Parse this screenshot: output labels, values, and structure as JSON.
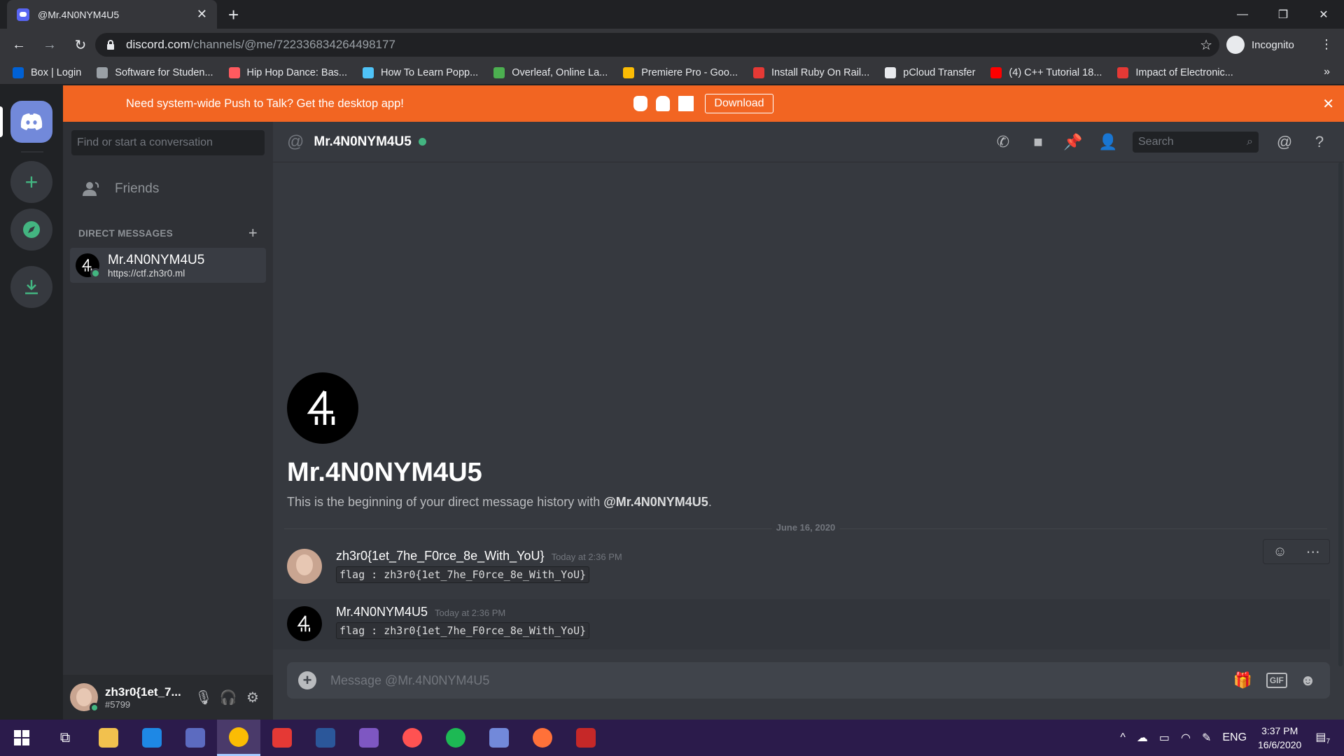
{
  "browser": {
    "tab_title": "@Mr.4N0NYM4U5",
    "url_host": "discord.com",
    "url_path": "/channels/@me/722336834264498177",
    "profile_label": "Incognito",
    "bookmarks": [
      {
        "label": "Box | Login",
        "color": "#0061d5"
      },
      {
        "label": "Software for Studen...",
        "color": "#9aa0a6"
      },
      {
        "label": "Hip Hop Dance: Bas...",
        "color": "#ff5a5f"
      },
      {
        "label": "How To Learn Popp...",
        "color": "#4fc3f7"
      },
      {
        "label": "Overleaf, Online La...",
        "color": "#4caf50"
      },
      {
        "label": "Premiere Pro - Goo...",
        "color": "#fbbc04"
      },
      {
        "label": "Install Ruby On Rail...",
        "color": "#e53935"
      },
      {
        "label": "pCloud Transfer",
        "color": "#e8eaed"
      },
      {
        "label": "(4) C++ Tutorial 18...",
        "color": "#ff0000"
      },
      {
        "label": "Impact of Electronic...",
        "color": "#e53935"
      }
    ]
  },
  "banner": {
    "message": "Need system-wide Push to Talk? Get the desktop app!",
    "download_label": "Download"
  },
  "sidebar": {
    "search_placeholder": "Find or start a conversation",
    "friends_label": "Friends",
    "dm_header": "DIRECT MESSAGES",
    "dm_items": [
      {
        "name": "Mr.4N0NYM4U5",
        "status_text": "https://ctf.zh3r0.ml"
      }
    ]
  },
  "user_panel": {
    "username": "zh3r0{1et_7...",
    "discriminator": "#5799"
  },
  "header": {
    "channel_name": "Mr.4N0NYM4U5",
    "search_placeholder": "Search"
  },
  "welcome": {
    "title": "Mr.4N0NYM4U5",
    "text_prefix": "This is the beginning of your direct message history with ",
    "text_user": "@Mr.4N0NYM4U5",
    "text_suffix": "."
  },
  "date_divider": "June 16, 2020",
  "messages": [
    {
      "author": "zh3r0{1et_7he_F0rce_8e_With_YoU}",
      "time": "Today at 2:36 PM",
      "content": "flag : zh3r0{1et_7he_F0rce_8e_With_YoU}"
    },
    {
      "author": "Mr.4N0NYM4U5",
      "time": "Today at 2:36 PM",
      "content": "flag : zh3r0{1et_7he_F0rce_8e_With_YoU}"
    }
  ],
  "composer": {
    "placeholder": "Message @Mr.4N0NYM4U5",
    "gif_label": "GIF"
  },
  "taskbar": {
    "language": "ENG",
    "time": "3:37 PM",
    "date": "16/6/2020",
    "notification_count": "7",
    "apps": [
      {
        "name": "file-explorer",
        "color": "#f2c14e"
      },
      {
        "name": "edge",
        "color": "#1e88e5"
      },
      {
        "name": "store",
        "color": "#5c6bc0"
      },
      {
        "name": "chrome",
        "color": "#fbbc04"
      },
      {
        "name": "acrobat",
        "color": "#e53935"
      },
      {
        "name": "word",
        "color": "#2b579a"
      },
      {
        "name": "intellij",
        "color": "#7e57c2"
      },
      {
        "name": "app-circle",
        "color": "#ff5252"
      },
      {
        "name": "spotify",
        "color": "#1db954"
      },
      {
        "name": "discord",
        "color": "#7289da"
      },
      {
        "name": "firefox",
        "color": "#ff7139"
      },
      {
        "name": "mcafee",
        "color": "#c62828"
      }
    ]
  }
}
